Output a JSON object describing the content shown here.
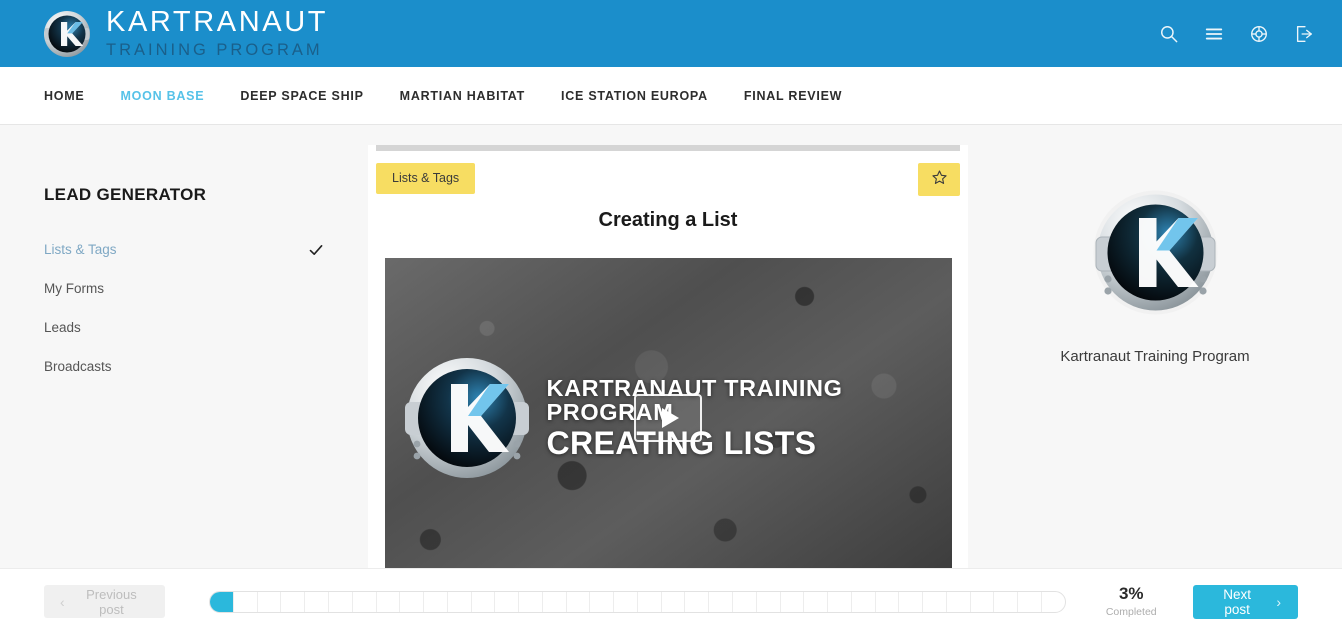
{
  "header": {
    "brand_title": "KARTRANAUT",
    "brand_subtitle": "TRAINING PROGRAM",
    "logo_letter": "K",
    "tools": [
      {
        "name": "search-icon",
        "label": "Search"
      },
      {
        "name": "menu-icon",
        "label": "Menu"
      },
      {
        "name": "support-icon",
        "label": "Support"
      },
      {
        "name": "logout-icon",
        "label": "Log out"
      }
    ],
    "colors": {
      "bar": "#1b8ecb",
      "subtitle": "#1a5f8a"
    }
  },
  "nav": {
    "items": [
      {
        "label": "HOME",
        "active": false
      },
      {
        "label": "MOON BASE",
        "active": true
      },
      {
        "label": "DEEP SPACE SHIP",
        "active": false
      },
      {
        "label": "MARTIAN HABITAT",
        "active": false
      },
      {
        "label": "ICE STATION EUROPA",
        "active": false
      },
      {
        "label": "FINAL REVIEW",
        "active": false
      }
    ],
    "active_color": "#56c2e8"
  },
  "sidebar": {
    "title": "LEAD GENERATOR",
    "items": [
      {
        "label": "Lists & Tags",
        "current": true,
        "checked": true
      },
      {
        "label": "My Forms",
        "current": false,
        "checked": false
      },
      {
        "label": "Leads",
        "current": false,
        "checked": false
      },
      {
        "label": "Broadcasts",
        "current": false,
        "checked": false
      }
    ]
  },
  "lesson": {
    "tag": "Lists & Tags",
    "favorite_icon": "star-icon",
    "title": "Creating a List",
    "tag_color": "#f7dd62",
    "video": {
      "line1": "KARTRANAUT TRAINING PROGRAM",
      "line2": "CREATING LISTS",
      "logo_letter": "K",
      "play_label": "Play"
    }
  },
  "right_panel": {
    "logo_letter": "K",
    "caption": "Kartranaut Training Program"
  },
  "footer": {
    "previous_label": "Previous post",
    "next_label": "Next post",
    "percent": "3%",
    "percent_caption": "Completed",
    "progress": {
      "total_segments": 36,
      "completed_segments": 1,
      "fill_color": "#2bb8dc"
    },
    "next_color": "#2bb8dc"
  }
}
